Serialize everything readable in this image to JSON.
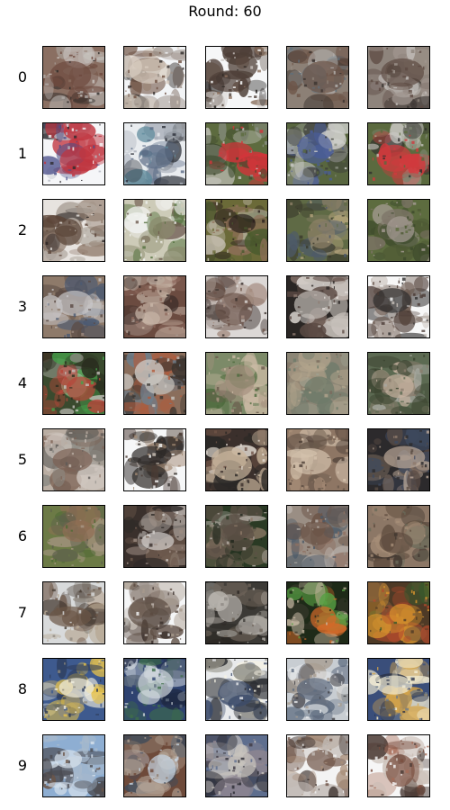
{
  "figure": {
    "title": "Round: 60"
  },
  "grid": {
    "rows": 10,
    "columns": 5,
    "row_labels": [
      "0",
      "1",
      "2",
      "3",
      "4",
      "5",
      "6",
      "7",
      "8",
      "9"
    ]
  },
  "tile_palettes": [
    [
      [
        "#8a6f62",
        "#6e4a3e",
        "#c9c4c0",
        "#2d2a28",
        "#b0aaa6"
      ],
      [
        "#f2f4f6",
        "#d9cdc0",
        "#6b4e3e",
        "#9a8e86",
        "#2f2b29"
      ],
      [
        "#f6f7f8",
        "#4e3f37",
        "#8b6f5c",
        "#c8c2be",
        "#24201e"
      ],
      [
        "#8c8076",
        "#6e5548",
        "#b7b4b2",
        "#5f6f7a",
        "#3b332f"
      ],
      [
        "#8e847c",
        "#5c4a42",
        "#c3bfbb",
        "#3a3431",
        "#a0968f"
      ]
    ],
    [
      [
        "#f5f6f8",
        "#c0343f",
        "#4a4f8a",
        "#2d2c30",
        "#b6bcc4"
      ],
      [
        "#e9ecef",
        "#5b6c86",
        "#2c3038",
        "#a7aeb8",
        "#5f8b9c"
      ],
      [
        "#5d6b3f",
        "#d3353a",
        "#c7c6c0",
        "#3e4a2e",
        "#8a8f84"
      ],
      [
        "#58663f",
        "#4a5c98",
        "#cfd0cc",
        "#3c3c3a",
        "#8f9486"
      ],
      [
        "#5b6a3f",
        "#d03a3d",
        "#c6c4bf",
        "#2f2f2e",
        "#7c8570"
      ]
    ],
    [
      [
        "#e7e3df",
        "#5a4437",
        "#8f7b6c",
        "#2c2624",
        "#b8b0a8"
      ],
      [
        "#cdcbb8",
        "#8a8a6c",
        "#53713d",
        "#f1f2f0",
        "#6d5a4e"
      ],
      [
        "#6b6a38",
        "#2a211d",
        "#8e6f58",
        "#c8c0b4",
        "#4a5a2e"
      ],
      [
        "#5f6a45",
        "#8e8168",
        "#b7a67e",
        "#4d5a6b",
        "#3a3a2c"
      ],
      [
        "#5d6c3f",
        "#a69c95",
        "#4f5a35",
        "#7e7468",
        "#3d4a2c"
      ]
    ],
    [
      [
        "#8e7a6a",
        "#c8c6c8",
        "#5a4a44",
        "#9c8a7f",
        "#4b5a72"
      ],
      [
        "#6b4b40",
        "#c9b7a8",
        "#3a2c28",
        "#8e6a5e",
        "#a99a90"
      ],
      [
        "#dcd8d6",
        "#6b5248",
        "#3a2f2c",
        "#a48c80",
        "#bfb6b0"
      ],
      [
        "#2a2624",
        "#c2bcb6",
        "#5b4a44",
        "#e1dcd8",
        "#8e7a70"
      ],
      [
        "#f7f7f7",
        "#2d2c2c",
        "#6e5c52",
        "#c8c0ba",
        "#4a3a34"
      ]
    ],
    [
      [
        "#3a4a2e",
        "#b6463a",
        "#c5c2bd",
        "#2a2d1f",
        "#46a04a"
      ],
      [
        "#8a6e5c",
        "#c8c4bf",
        "#b25a3a",
        "#6e7e8c",
        "#3a342f"
      ],
      [
        "#7c8a68",
        "#a69280",
        "#4c6a3c",
        "#c9b9a3",
        "#6a5a4c"
      ],
      [
        "#8c8676",
        "#6e7a6a",
        "#b2a48c",
        "#7a6a5c",
        "#9ea08e"
      ],
      [
        "#5c6a52",
        "#c6b2a0",
        "#3b4430",
        "#8a7d6e",
        "#a7a8a0"
      ]
    ],
    [
      [
        "#b9ada2",
        "#7d6355",
        "#8b8a84",
        "#cfc6bf",
        "#5e5a56"
      ],
      [
        "#f6f7f8",
        "#2e2a28",
        "#a08872",
        "#4a3a32",
        "#ccc2b8"
      ],
      [
        "#3b302c",
        "#c9b59c",
        "#6e5246",
        "#e6dfd6",
        "#2a2826"
      ],
      [
        "#8e7664",
        "#d4c2ad",
        "#6a5a4c",
        "#a98e78",
        "#4c3e36"
      ],
      [
        "#2c2a2c",
        "#bba898",
        "#5a4c44",
        "#3e4a5e",
        "#8e7a6c"
      ]
    ],
    [
      [
        "#6c7a46",
        "#8e6e54",
        "#4e6a34",
        "#a79684",
        "#5c5e4c"
      ],
      [
        "#3a302c",
        "#d6d2ce",
        "#6e5a4e",
        "#2e2a28",
        "#9c8c82"
      ],
      [
        "#2a3a24",
        "#5c5046",
        "#8c7866",
        "#b5aea6",
        "#1f261c"
      ],
      [
        "#9a8e84",
        "#6c5548",
        "#bdb6b0",
        "#4c5a68",
        "#8e7062"
      ],
      [
        "#8c7766",
        "#5e4c3e",
        "#a68e78",
        "#6a6a5a",
        "#3e342e"
      ]
    ],
    [
      [
        "#d8dadb",
        "#6b5546",
        "#b6a692",
        "#8f8880",
        "#4a3e36"
      ],
      [
        "#f5f6f7",
        "#5a4a40",
        "#a89a8c",
        "#c4bcb4",
        "#3a302c"
      ],
      [
        "#3c3a36",
        "#b8b4ae",
        "#6e645a",
        "#2a2622",
        "#8e8a84"
      ],
      [
        "#1e2a18",
        "#d36a2a",
        "#58a044",
        "#c8b9a4",
        "#3c3a2e"
      ],
      [
        "#4e3a26",
        "#d8942e",
        "#7c5c3a",
        "#3a5a2c",
        "#b34a2c"
      ]
    ],
    [
      [
        "#3e5a8e",
        "#f2efe0",
        "#8e8a7c",
        "#2c3a58",
        "#e6c24a"
      ],
      [
        "#2e4270",
        "#cfd6dc",
        "#5e6c7e",
        "#1f2a44",
        "#3e6e4a"
      ],
      [
        "#e8eaec",
        "#3a4a6a",
        "#8c8a80",
        "#f6f3e4",
        "#2a2c30"
      ],
      [
        "#c8cdd2",
        "#5c6a7e",
        "#3e3e44",
        "#a89c90",
        "#e7e9eb"
      ],
      [
        "#3a4e7a",
        "#f2ecd4",
        "#6c7a8c",
        "#2a3248",
        "#d8a648"
      ]
    ],
    [
      [
        "#8eaed2",
        "#d8e2ec",
        "#6b5546",
        "#a7b9cc",
        "#4a4a50"
      ],
      [
        "#6e4a3a",
        "#c8d6e4",
        "#8e7a6c",
        "#3e4a5a",
        "#b2a294"
      ],
      [
        "#5e6e8e",
        "#c9c4be",
        "#3e3a44",
        "#8e8690",
        "#2a2a32"
      ],
      [
        "#f3f3f3",
        "#6e5246",
        "#a88e7a",
        "#c2bbb6",
        "#3a2e2a"
      ],
      [
        "#f6f6f6",
        "#7a4e3e",
        "#a66c58",
        "#c9bdb4",
        "#4a3a34"
      ]
    ]
  ]
}
